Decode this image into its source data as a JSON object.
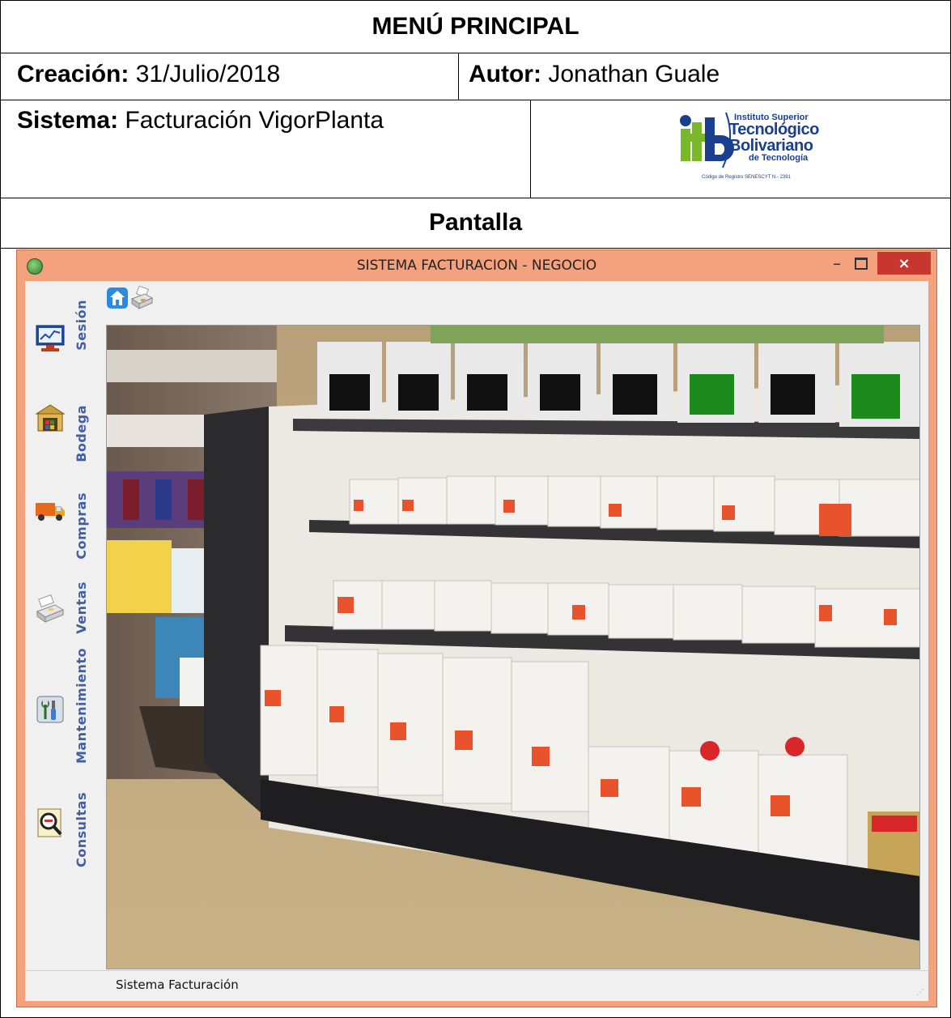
{
  "document": {
    "title": "MENÚ PRINCIPAL",
    "creation_label": "Creación:",
    "creation_value": "31/Julio/2018",
    "author_label": "Autor:",
    "author_value": "Jonathan Guale",
    "system_label": "Sistema:",
    "system_value": "Facturación VigorPlanta",
    "screen_label": "Pantalla"
  },
  "logo": {
    "line1": "Instituto Superior",
    "line2": "Tecnológico",
    "line3": "Bolivariano",
    "line4": "de Tecnología",
    "line5": "Código de Registro SENESCYT N.- 2391",
    "mark": "itb"
  },
  "window": {
    "title": "SISTEMA FACTURACION - NEGOCIO",
    "min_glyph": "–",
    "close_glyph": "×",
    "status_text": "Sistema Facturación"
  },
  "sidebar": {
    "items": [
      {
        "label": "Sesión",
        "icon": "monitor-chart-icon"
      },
      {
        "label": "Bodega",
        "icon": "warehouse-icon"
      },
      {
        "label": "Compras",
        "icon": "truck-icon"
      },
      {
        "label": "Ventas",
        "icon": "cash-register-icon"
      },
      {
        "label": "Mantenimiento",
        "icon": "tools-icon"
      },
      {
        "label": "Consultas",
        "icon": "search-document-icon"
      }
    ]
  },
  "toolbar": {
    "buttons": [
      {
        "icon": "home-icon"
      },
      {
        "icon": "printer-icon"
      }
    ]
  },
  "colors": {
    "window_frame": "#f4a27e",
    "close_button": "#c7372f",
    "sidebar_text": "#3f5fa6",
    "logo_blue": "#1a3f8f",
    "logo_green": "#79b829"
  }
}
